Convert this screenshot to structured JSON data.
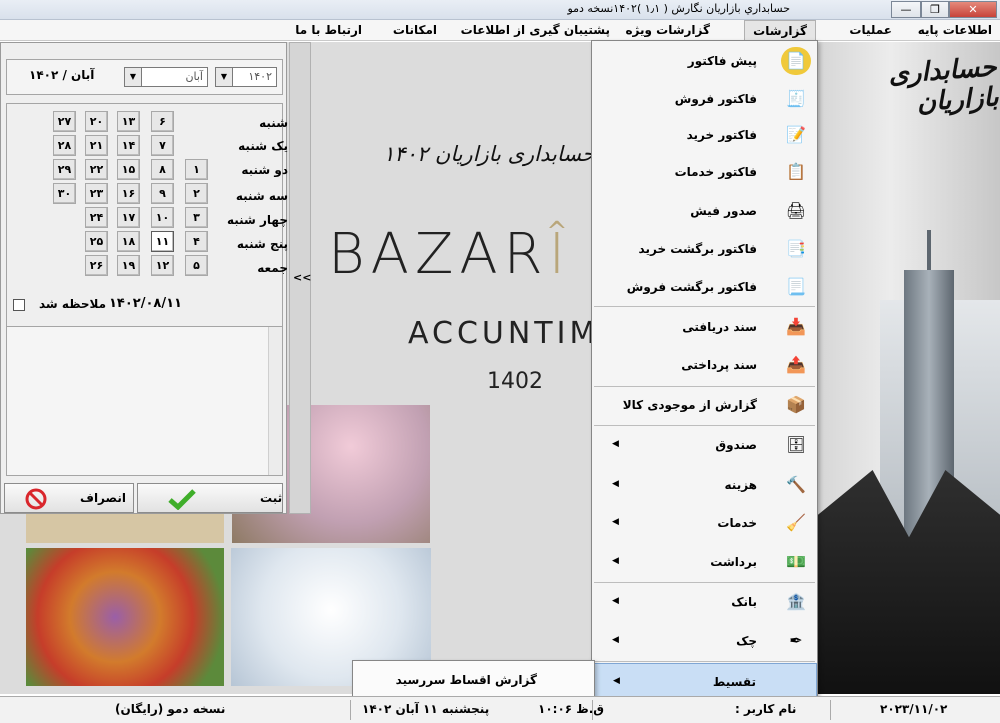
{
  "window": {
    "title": "حسابداري بازاريان نگارش ( ۱٫۱ )۱۴۰۲نسخه دمو",
    "minimize": "—",
    "restore": "❐",
    "close": "✕"
  },
  "menubar": {
    "items": [
      {
        "label": "اطلاعات پایه"
      },
      {
        "label": "عملیات"
      },
      {
        "label": "گزارشات"
      },
      {
        "label": "گزارشات ویژه"
      },
      {
        "label": "پشتیبان گیری از اطلاعات"
      },
      {
        "label": "امکانات"
      },
      {
        "label": "ارتباط با ما"
      }
    ]
  },
  "branding": {
    "side_logo": "حسابداری بازاریان",
    "center_fa": "حسابداری بازاریان ۱۴۰۲",
    "center_en_dark": "BAZAR",
    "center_en_gold": "Î",
    "center_en_dark2": "",
    "center_sub": "ACCUNTIM",
    "center_year": "1402"
  },
  "calendar": {
    "header_label": "آبان / ۱۴۰۲",
    "year_value": "۱۴۰۲",
    "month_value": "آبان",
    "weekdays": [
      "شنبه",
      "یک شنبه",
      "دو شنبه",
      "سه شنبه",
      "چهار شنبه",
      "پنج شنبه",
      "جمعه"
    ],
    "days": [
      [
        "",
        "۶",
        "۱۳",
        "۲۰",
        "۲۷"
      ],
      [
        "",
        "۷",
        "۱۴",
        "۲۱",
        "۲۸"
      ],
      [
        "۱",
        "۸",
        "۱۵",
        "۲۲",
        "۲۹"
      ],
      [
        "۲",
        "۹",
        "۱۶",
        "۲۳",
        "۳۰"
      ],
      [
        "۳",
        "۱۰",
        "۱۷",
        "۲۴",
        ""
      ],
      [
        "۴",
        "۱۱",
        "۱۸",
        "۲۵",
        ""
      ],
      [
        "۵",
        "۱۲",
        "۱۹",
        "۲۶",
        ""
      ]
    ],
    "today": "۱۱",
    "note_label": "ملاحظه شد",
    "selected_date": "۱۴۰۲/۰۸/۱۱",
    "save_label": "ثبت",
    "cancel_label": "انصراف",
    "collapse_label": "<<"
  },
  "reports_menu": {
    "items": [
      {
        "label": "پیش فاکتور",
        "icon": "proforma-icon",
        "submenu": false
      },
      {
        "label": "فاکتور فروش",
        "icon": "sales-invoice-icon",
        "submenu": false
      },
      {
        "label": "فاکتور خرید",
        "icon": "purchase-invoice-icon",
        "submenu": false
      },
      {
        "label": "فاکتور خدمات",
        "icon": "service-invoice-icon",
        "submenu": false
      },
      {
        "label": "صدور فیش",
        "icon": "receipt-printer-icon",
        "submenu": false
      },
      {
        "label": "فاکتور برگشت خرید",
        "icon": "purchase-return-icon",
        "submenu": false
      },
      {
        "label": "فاکتور برگشت فروش",
        "icon": "sales-return-icon",
        "submenu": false
      },
      {
        "label": "سند دریافتی",
        "icon": "receipt-doc-icon",
        "submenu": false
      },
      {
        "label": "سند پرداختی",
        "icon": "payment-doc-icon",
        "submenu": false
      },
      {
        "label": "گزارش از موجودی کالا",
        "icon": "inventory-icon",
        "submenu": false
      },
      {
        "label": "صندوق",
        "icon": "cashbox-icon",
        "submenu": true
      },
      {
        "label": "هزینه",
        "icon": "expense-icon",
        "submenu": true
      },
      {
        "label": "خدمات",
        "icon": "services-icon",
        "submenu": true
      },
      {
        "label": "برداشت",
        "icon": "withdrawal-icon",
        "submenu": true
      },
      {
        "label": "بانک",
        "icon": "bank-icon",
        "submenu": true
      },
      {
        "label": "چک",
        "icon": "cheque-icon",
        "submenu": true
      },
      {
        "label": "تقسیط",
        "icon": "",
        "submenu": true
      }
    ],
    "submenu_item": "گزارش اقساط سررسید"
  },
  "statusbar": {
    "date_gregorian": "۲۰۲۳/۱۱/۰۲",
    "user_label": "نام کاربر :",
    "time": "ق.ظ ۱۰:۰۶",
    "date_persian": "پنجشنبه ۱۱ آبان ۱۴۰۲",
    "edition": "نسخه دمو (رایگان)"
  },
  "colors": {
    "menu_highlight": "#c9def5",
    "accent_gold": "#b9a67a",
    "cancel_red": "#d9262c",
    "ok_green": "#3fae2a"
  }
}
